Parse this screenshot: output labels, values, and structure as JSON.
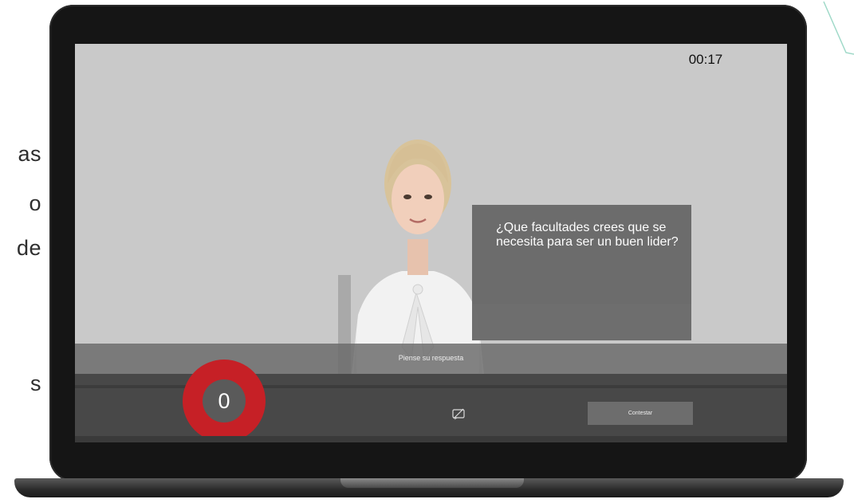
{
  "slide_side_text": [
    "as",
    "o",
    "de",
    "s"
  ],
  "app": {
    "timer": "00:17",
    "question": "¿Que facultades crees que se necesita para ser un buen lider?",
    "hint": "Piense su respuesta",
    "countdown_value": "0",
    "answer_button_label": "Contestar",
    "subtitle_icon": "subtitle-off-icon"
  },
  "colors": {
    "screen_bg": "#c9c9c9",
    "countdown_ring": "#c62026",
    "bottom_bar": "#484848",
    "question_box": "#6a6a6a"
  }
}
